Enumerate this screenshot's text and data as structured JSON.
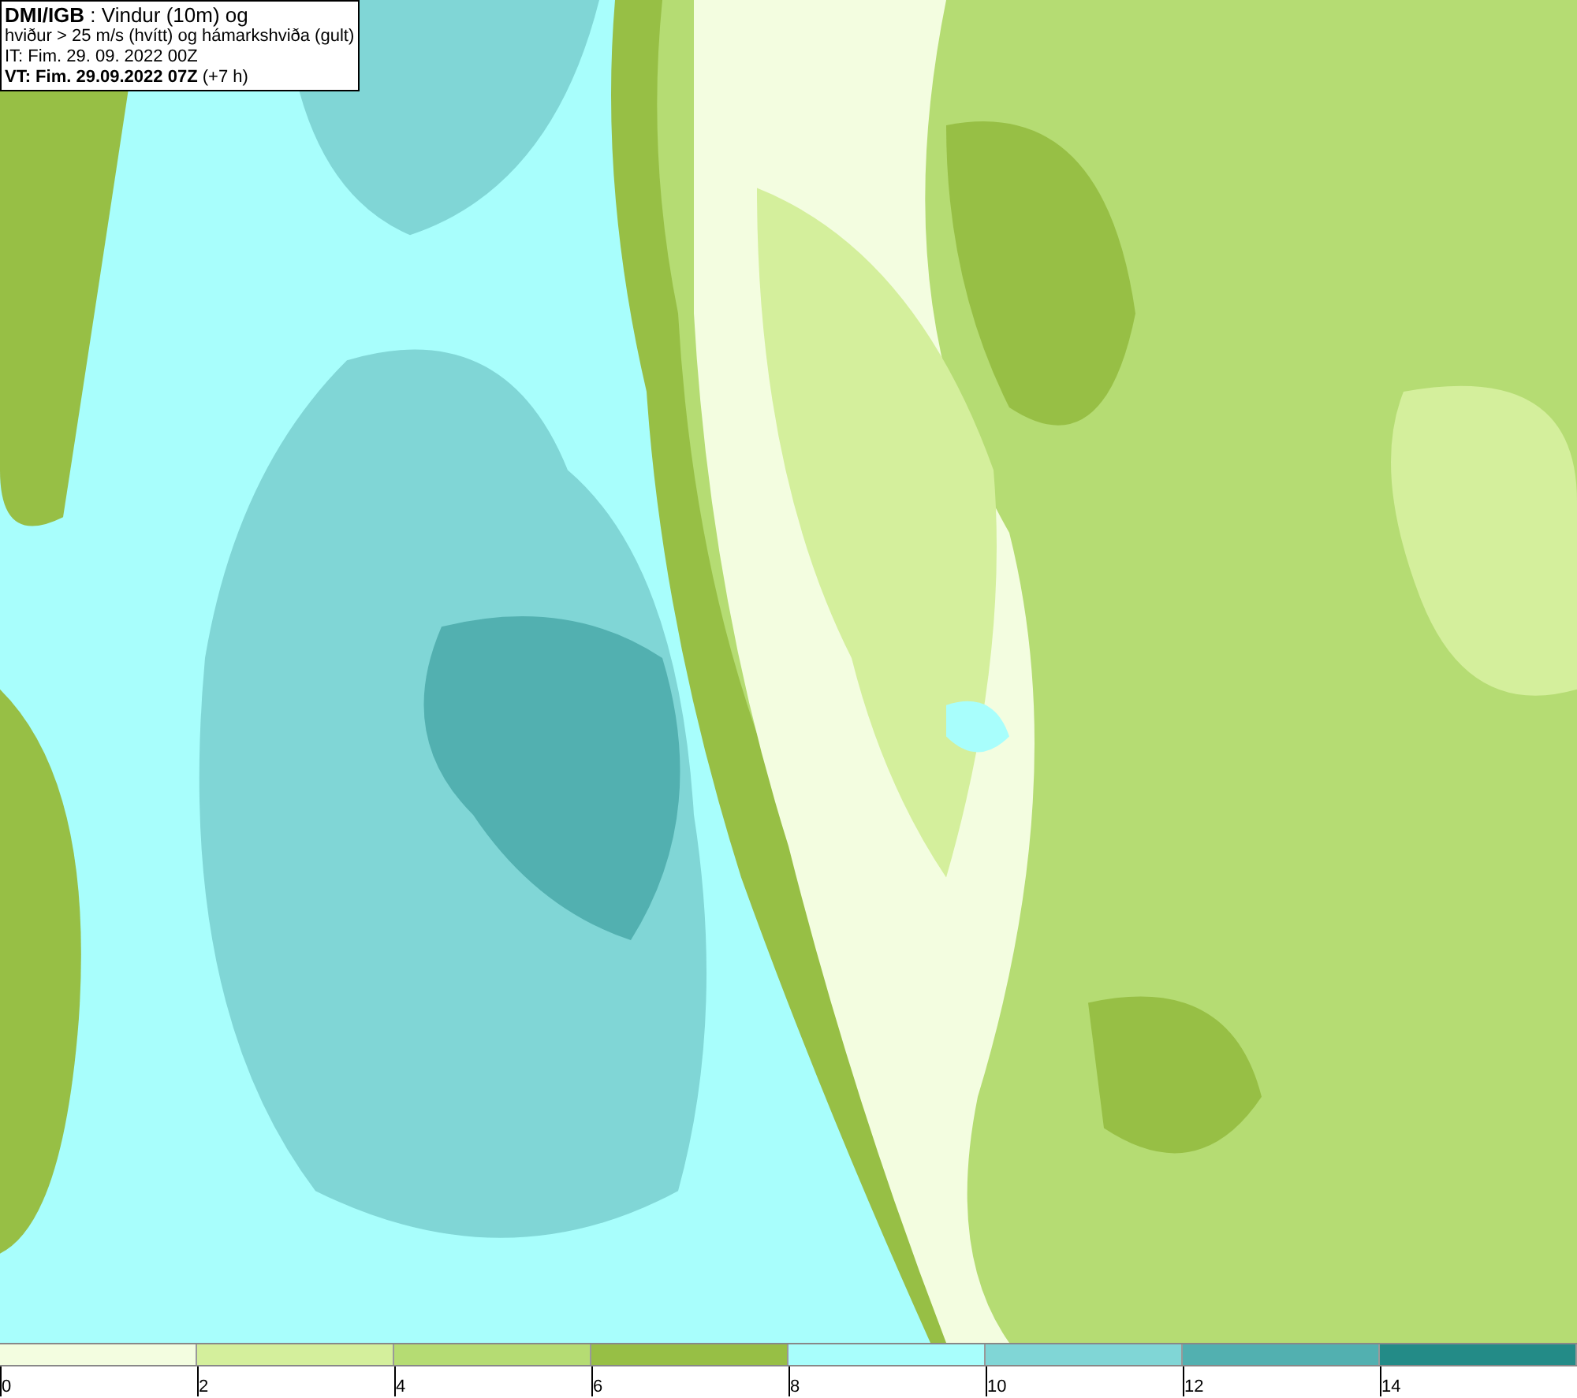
{
  "title_box": {
    "lines": [
      "**DMI/IGB** : Vindur (10m) og",
      "hviður > 25 m/s (hvítt) og hámarkshviða (gult)",
      "IT: Fim. 29. 09. 2022 00Z",
      "**VT: Fim. 29.09.2022 07Z** (+7 h)"
    ]
  },
  "legend": [
    {
      "label": "0",
      "color": "#f3fde0"
    },
    {
      "label": "2",
      "color": "#d4ef9c"
    },
    {
      "label": "4",
      "color": "#b5dc73"
    },
    {
      "label": "6",
      "color": "#97bf45"
    },
    {
      "label": "8",
      "color": "#a8fefc"
    },
    {
      "label": "10",
      "color": "#80d6d6"
    },
    {
      "label": "12",
      "color": "#52b0b0"
    },
    {
      "label": "14",
      "color": "#238b87"
    }
  ]
}
